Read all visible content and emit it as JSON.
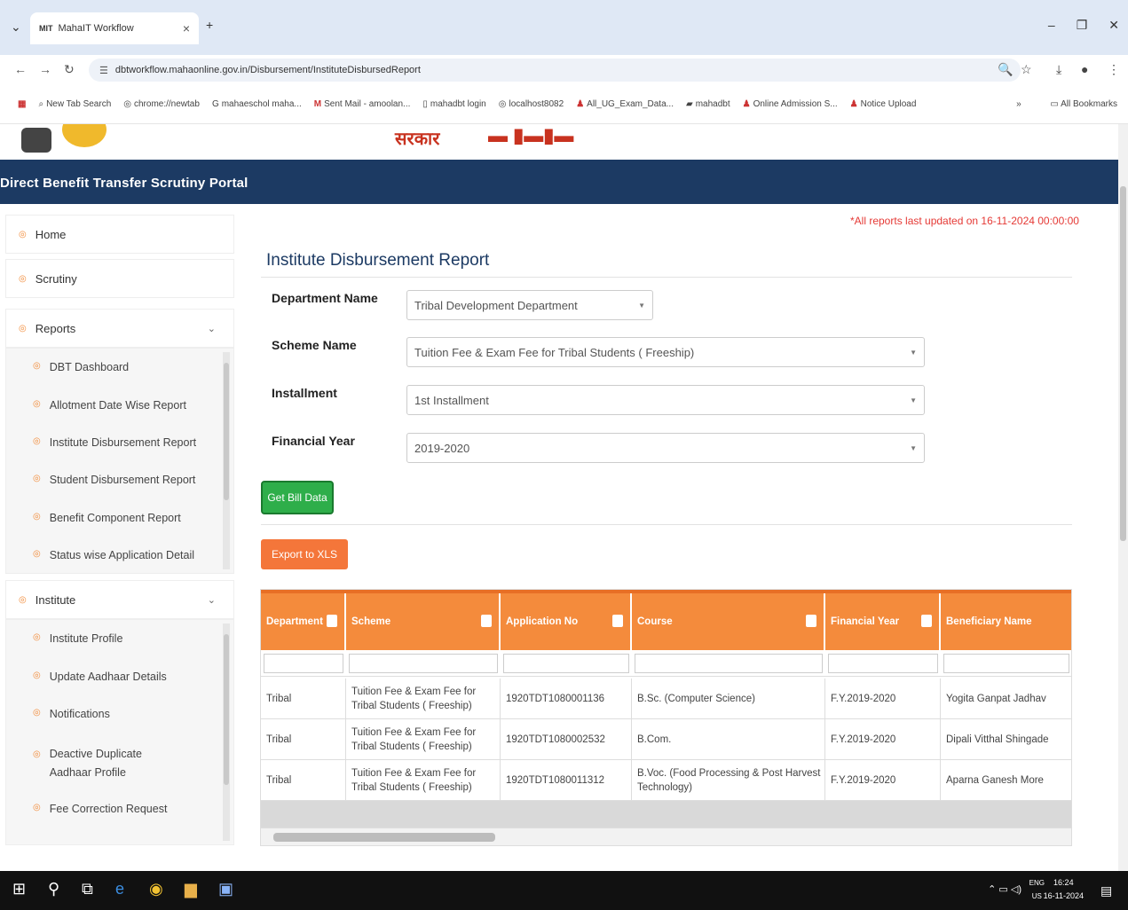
{
  "browser": {
    "tab_title": "MahaIT Workflow",
    "tab_favicon": "MIT",
    "new_tab_symbol": "+",
    "url": "dbtworkflow.mahaonline.gov.in/Disbursement/InstituteDisbursedReport",
    "bookmarks": [
      {
        "icon": "grid-icon",
        "label": ""
      },
      {
        "icon": "search-icon",
        "label": "New Tab Search"
      },
      {
        "icon": "globe-icon",
        "label": "chrome://newtab"
      },
      {
        "icon": "google-icon",
        "label": "mahaeschol maha..."
      },
      {
        "icon": "gmail-icon",
        "label": "Sent Mail - amoolan..."
      },
      {
        "icon": "doc-icon",
        "label": "mahadbt login"
      },
      {
        "icon": "globe-icon",
        "label": "localhost8082"
      },
      {
        "icon": "person-icon",
        "label": "All_UG_Exam_Data..."
      },
      {
        "icon": "mit-icon",
        "label": "mahadbt"
      },
      {
        "icon": "person-icon",
        "label": "Online Admission S..."
      },
      {
        "icon": "person-icon",
        "label": "Notice Upload"
      }
    ],
    "more_bookmarks": "»",
    "all_bookmarks": "All Bookmarks"
  },
  "header": {
    "logo_text": "सरकार",
    "portal_title": "Direct Benefit Transfer Scrutiny Portal"
  },
  "sidebar": {
    "home": "Home",
    "scrutiny": "Scrutiny",
    "reports": "Reports",
    "reports_items": [
      "DBT Dashboard",
      "Allotment Date Wise Report",
      "Institute Disbursement Report",
      "Student Disbursement Report",
      "Benefit Component Report",
      "Status wise Application Detail"
    ],
    "institute": "Institute",
    "institute_items": [
      "Institute Profile",
      "Update Aadhaar Details",
      "Notifications",
      "Deactive Duplicate Aadhaar Profile",
      "Fee Correction Request"
    ]
  },
  "main": {
    "updated_notice": "*All reports last updated on 16-11-2024 00:00:00",
    "title": "Institute Disbursement Report",
    "fields": {
      "department_label": "Department Name",
      "department_value": "Tribal Development Department",
      "scheme_label": "Scheme Name",
      "scheme_value": "Tuition Fee & Exam Fee for Tribal Students ( Freeship)",
      "installment_label": "Installment",
      "installment_value": "1st Installment",
      "year_label": "Financial Year",
      "year_value": "2019-2020"
    },
    "get_bill_button": "Get Bill Data",
    "export_button": "Export to XLS"
  },
  "table": {
    "columns": [
      "Department",
      "Scheme",
      "Application No",
      "Course",
      "Financial Year",
      "Beneficiary Name"
    ],
    "rows": [
      [
        "Tribal",
        "Tuition Fee & Exam Fee for Tribal Students ( Freeship)",
        "1920TDT1080001136",
        "B.Sc. (Computer Science)",
        "F.Y.2019-2020",
        "Yogita Ganpat Jadhav"
      ],
      [
        "Tribal",
        "Tuition Fee & Exam Fee for Tribal Students ( Freeship)",
        "1920TDT1080002532",
        "B.Com.",
        "F.Y.2019-2020",
        "Dipali Vitthal Shingade"
      ],
      [
        "Tribal",
        "Tuition Fee & Exam Fee for Tribal Students ( Freeship)",
        "1920TDT1080011312",
        "B.Voc. (Food Processing & Post Harvest Technology)",
        "F.Y.2019-2020",
        "Aparna Ganesh More"
      ]
    ]
  },
  "taskbar": {
    "lang_top": "ENG",
    "lang_bottom": "US",
    "time": "16:24",
    "date": "16-11-2024"
  }
}
